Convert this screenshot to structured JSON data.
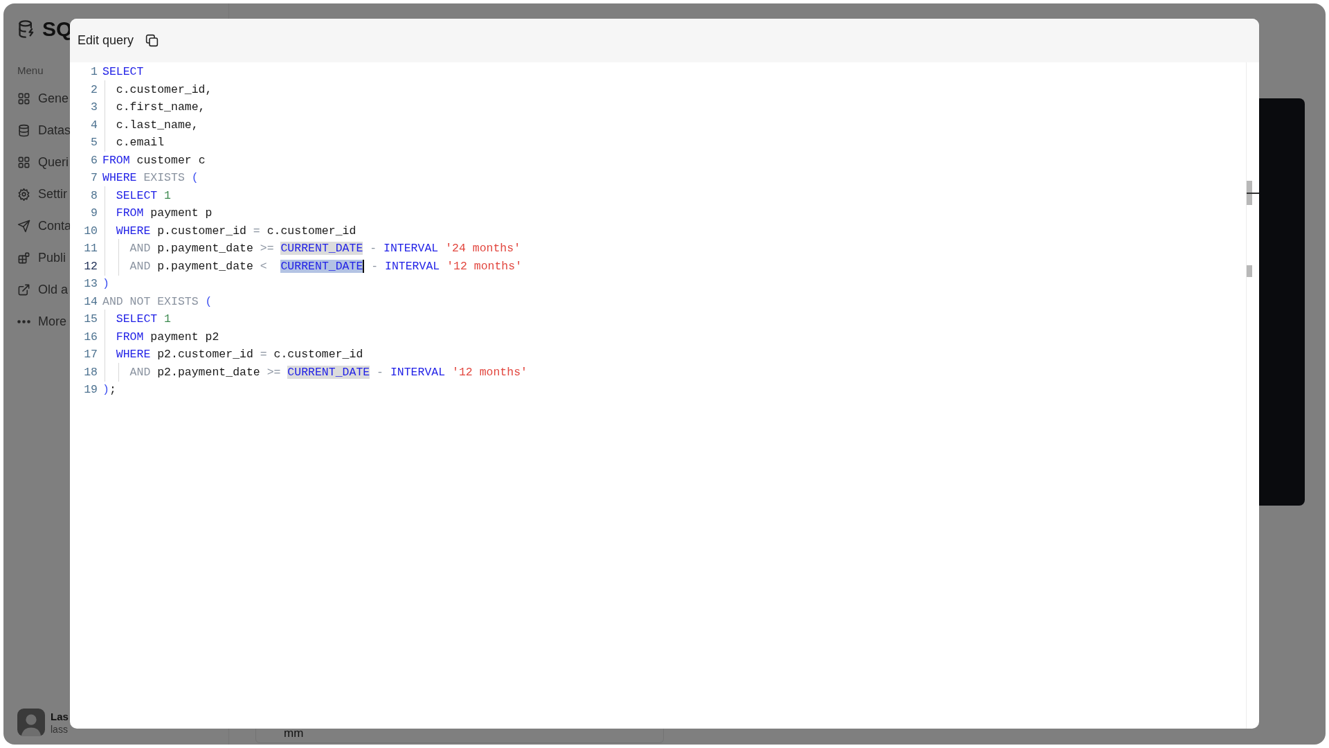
{
  "app": {
    "logo_text": "SQ"
  },
  "sidebar": {
    "heading": "Menu",
    "items": [
      {
        "label": "Gene"
      },
      {
        "label": "Datas"
      },
      {
        "label": "Queri"
      },
      {
        "label": "Settir"
      },
      {
        "label": "Conta"
      },
      {
        "label": "Publi"
      },
      {
        "label": "Old a"
      },
      {
        "label": "More"
      }
    ]
  },
  "user": {
    "name": "Las",
    "email": "lass"
  },
  "background_field": {
    "value": "mm"
  },
  "modal": {
    "title": "Edit query",
    "lines": [
      {
        "number": "1",
        "active": false,
        "tokens": [
          {
            "kind": "keyword",
            "text": "SELECT"
          }
        ]
      },
      {
        "number": "2",
        "active": false,
        "tokens": [
          {
            "kind": "plain",
            "text": "  c.customer_id,"
          }
        ]
      },
      {
        "number": "3",
        "active": false,
        "tokens": [
          {
            "kind": "plain",
            "text": "  c.first_name,"
          }
        ]
      },
      {
        "number": "4",
        "active": false,
        "tokens": [
          {
            "kind": "plain",
            "text": "  c.last_name,"
          }
        ]
      },
      {
        "number": "5",
        "active": false,
        "tokens": [
          {
            "kind": "plain",
            "text": "  c.email"
          }
        ]
      },
      {
        "number": "6",
        "active": false,
        "tokens": [
          {
            "kind": "keyword",
            "text": "FROM"
          },
          {
            "kind": "plain",
            "text": " customer c"
          }
        ]
      },
      {
        "number": "7",
        "active": false,
        "tokens": [
          {
            "kind": "keyword",
            "text": "WHERE"
          },
          {
            "kind": "operator",
            "text": " EXISTS"
          },
          {
            "kind": "paren",
            "text": " ("
          }
        ]
      },
      {
        "number": "8",
        "active": false,
        "tokens": [
          {
            "kind": "keyword",
            "text": "  SELECT"
          },
          {
            "kind": "number",
            "text": " 1"
          }
        ]
      },
      {
        "number": "9",
        "active": false,
        "tokens": [
          {
            "kind": "keyword",
            "text": "  FROM"
          },
          {
            "kind": "plain",
            "text": " payment p"
          }
        ]
      },
      {
        "number": "10",
        "active": false,
        "tokens": [
          {
            "kind": "keyword",
            "text": "  WHERE"
          },
          {
            "kind": "plain",
            "text": " p.customer_id "
          },
          {
            "kind": "operator",
            "text": "="
          },
          {
            "kind": "plain",
            "text": " c.customer_id"
          }
        ]
      },
      {
        "number": "11",
        "active": false,
        "tokens": [
          {
            "kind": "operator",
            "text": "    AND"
          },
          {
            "kind": "plain",
            "text": " p.payment_date "
          },
          {
            "kind": "operator",
            "text": ">= "
          },
          {
            "kind": "match",
            "text": "CURRENT_DATE"
          },
          {
            "kind": "operator",
            "text": " -"
          },
          {
            "kind": "keyword",
            "text": " INTERVAL"
          },
          {
            "kind": "string",
            "text": " '24 months'"
          }
        ]
      },
      {
        "number": "12",
        "active": true,
        "tokens": [
          {
            "kind": "operator",
            "text": "    AND"
          },
          {
            "kind": "plain",
            "text": " p.payment_date "
          },
          {
            "kind": "operator",
            "text": "<  "
          },
          {
            "kind": "selection",
            "text": "CURRENT_DATE"
          },
          {
            "kind": "operator",
            "text": " -"
          },
          {
            "kind": "keyword",
            "text": " INTERVAL"
          },
          {
            "kind": "string",
            "text": " '12 months'"
          }
        ]
      },
      {
        "number": "13",
        "active": false,
        "tokens": [
          {
            "kind": "paren",
            "text": ")"
          }
        ]
      },
      {
        "number": "14",
        "active": false,
        "tokens": [
          {
            "kind": "operator",
            "text": "AND NOT EXISTS"
          },
          {
            "kind": "paren",
            "text": " ("
          }
        ]
      },
      {
        "number": "15",
        "active": false,
        "tokens": [
          {
            "kind": "keyword",
            "text": "  SELECT"
          },
          {
            "kind": "number",
            "text": " 1"
          }
        ]
      },
      {
        "number": "16",
        "active": false,
        "tokens": [
          {
            "kind": "keyword",
            "text": "  FROM"
          },
          {
            "kind": "plain",
            "text": " payment p2"
          }
        ]
      },
      {
        "number": "17",
        "active": false,
        "tokens": [
          {
            "kind": "keyword",
            "text": "  WHERE"
          },
          {
            "kind": "plain",
            "text": " p2.customer_id "
          },
          {
            "kind": "operator",
            "text": "="
          },
          {
            "kind": "plain",
            "text": " c.customer_id"
          }
        ]
      },
      {
        "number": "18",
        "active": false,
        "tokens": [
          {
            "kind": "operator",
            "text": "    AND"
          },
          {
            "kind": "plain",
            "text": " p2.payment_date "
          },
          {
            "kind": "operator",
            "text": ">= "
          },
          {
            "kind": "match",
            "text": "CURRENT_DATE"
          },
          {
            "kind": "operator",
            "text": " -"
          },
          {
            "kind": "keyword",
            "text": " INTERVAL"
          },
          {
            "kind": "string",
            "text": " '12 months'"
          }
        ]
      },
      {
        "number": "19",
        "active": false,
        "tokens": [
          {
            "kind": "paren",
            "text": ")"
          },
          {
            "kind": "plain",
            "text": ";"
          }
        ]
      }
    ]
  }
}
